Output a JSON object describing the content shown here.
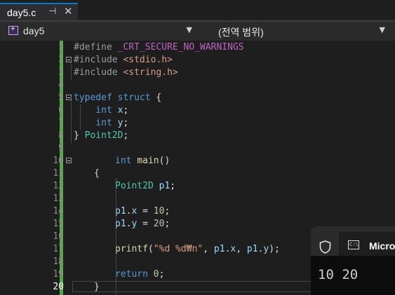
{
  "tab": {
    "title": "day5.c",
    "pin_glyph": "⊣",
    "close_glyph": "✕"
  },
  "navbar": {
    "project": "day5",
    "scope": "(전역 범위)"
  },
  "editor": {
    "current_line": 20,
    "lines": [
      {
        "n": "1"
      },
      {
        "n": "2"
      },
      {
        "n": "3"
      },
      {
        "n": "4"
      },
      {
        "n": "5"
      },
      {
        "n": "6"
      },
      {
        "n": "7"
      },
      {
        "n": "8"
      },
      {
        "n": "9"
      },
      {
        "n": "10"
      },
      {
        "n": "11"
      },
      {
        "n": "12"
      },
      {
        "n": "13"
      },
      {
        "n": "14"
      },
      {
        "n": "15"
      },
      {
        "n": "16"
      },
      {
        "n": "17"
      },
      {
        "n": "18"
      },
      {
        "n": "19"
      },
      {
        "n": "20"
      }
    ],
    "code": {
      "l1_a": "#define ",
      "l1_b": "_CRT_SECURE_NO_WARNINGS",
      "l2_a": "#include ",
      "l2_b": "<stdio.h>",
      "l3_a": "#include ",
      "l3_b": "<string.h>",
      "l5_a": "typedef ",
      "l5_b": "struct",
      "l5_c": " {",
      "l6_a": "    int ",
      "l6_b": "x",
      "l6_c": ";",
      "l7_a": "    int ",
      "l7_b": "y",
      "l7_c": ";",
      "l8_a": "} ",
      "l8_b": "Point2D",
      "l8_c": ";",
      "l10_a": "int ",
      "l10_b": "main",
      "l10_c": "()",
      "l11": "{",
      "l12_a": "Point2D ",
      "l12_b": "p1",
      "l12_c": ";",
      "l14_a": "p1",
      "l14_b": ".",
      "l14_c": "x",
      "l14_d": " = ",
      "l14_e": "10",
      "l14_f": ";",
      "l15_a": "p1",
      "l15_b": ".",
      "l15_c": "y",
      "l15_d": " = ",
      "l15_e": "20",
      "l15_f": ";",
      "l17_a": "printf",
      "l17_b": "(",
      "l17_c": "\"%d %d₩n\"",
      "l17_d": ", ",
      "l17_e": "p1",
      "l17_f": ".",
      "l17_g": "x",
      "l17_h": ", ",
      "l17_i": "p1",
      "l17_j": ".",
      "l17_k": "y",
      "l17_l": ");",
      "l19_a": "return ",
      "l19_b": "0",
      "l19_c": ";",
      "l20": "}"
    }
  },
  "console": {
    "tab_label": "Micro",
    "cmd_glyph": "C:\\",
    "output": "10 20"
  },
  "colors": {
    "keyword": "#569cd6",
    "type": "#4ec9b0",
    "string": "#d69d85",
    "number": "#b5cea8",
    "function": "#dcdcaa",
    "macro": "#bd63c5",
    "change_bar": "#57a64a",
    "accent": "#007acc"
  }
}
